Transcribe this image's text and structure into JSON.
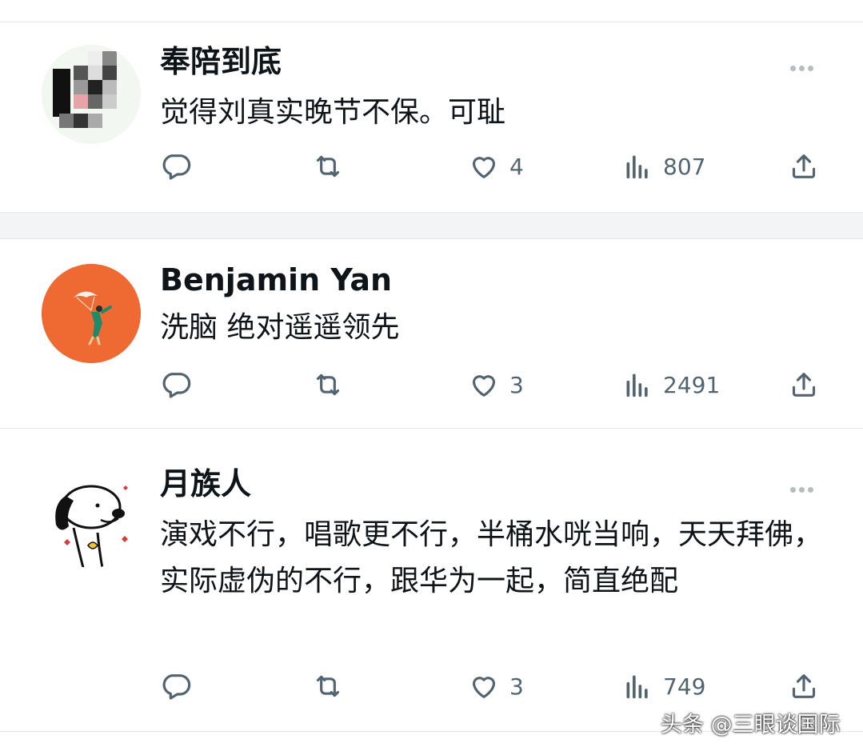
{
  "tweets": [
    {
      "author": "奉陪到底",
      "text": "觉得刘真实晚节不保。可耻",
      "likes": "4",
      "views": "807",
      "avatar_icon": "pixelated-avatar",
      "has_more_menu": true
    },
    {
      "author": "Benjamin Yan",
      "text": "洗脑 绝对遥遥领先",
      "likes": "3",
      "views": "2491",
      "avatar_icon": "parachute-figure-avatar",
      "avatar_color": "#ef6a32",
      "has_more_menu": false
    },
    {
      "author": "月族人",
      "text": "演戏不行，唱歌更不行，半桶水咣当响，天天拜佛，实际虚伪的不行，跟华为一起，简直绝配",
      "likes": "3",
      "views": "749",
      "avatar_icon": "snoopy-avatar",
      "has_more_menu": true
    }
  ],
  "icons": {
    "reply": "reply-icon",
    "retweet": "retweet-icon",
    "like": "heart-icon",
    "views": "views-chart-icon",
    "share": "share-icon",
    "more": "more-icon"
  },
  "watermark": "头条 @三眼谈国际"
}
